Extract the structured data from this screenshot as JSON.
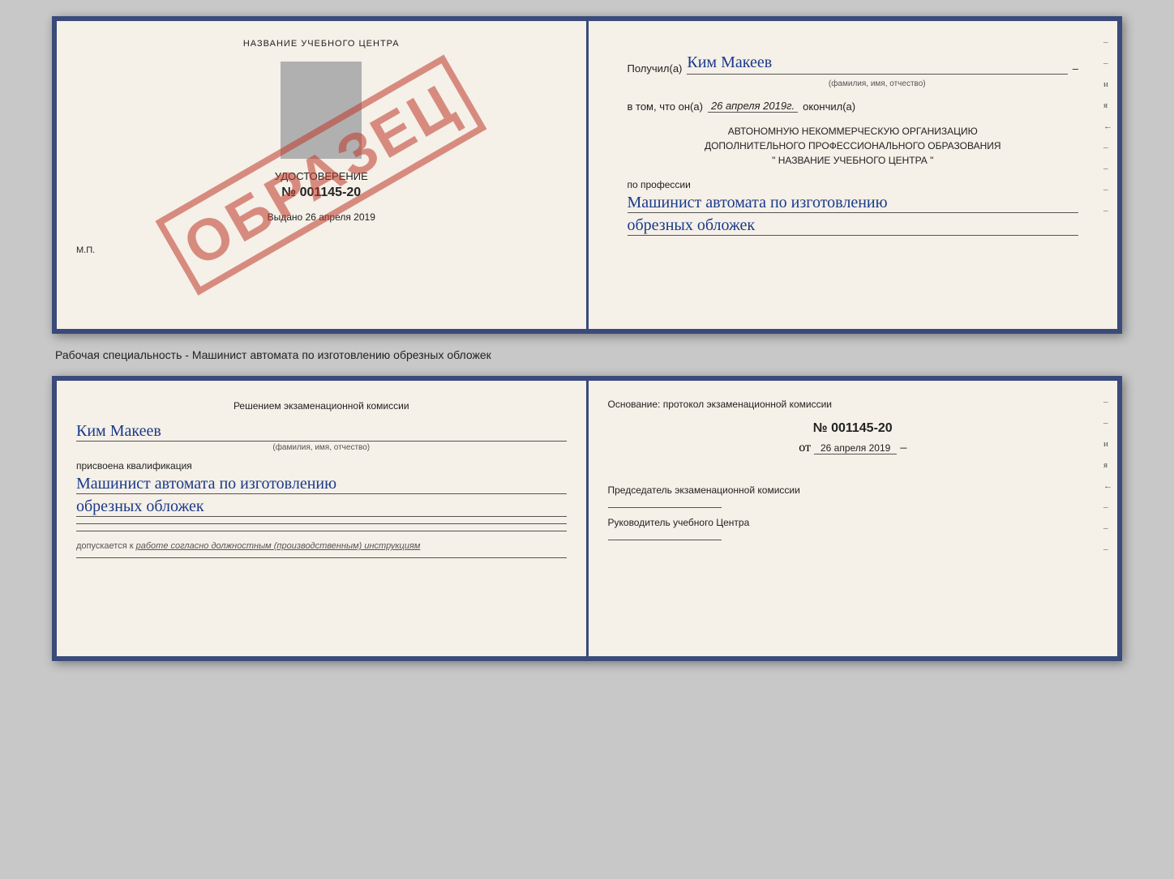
{
  "top_doc": {
    "left": {
      "title": "НАЗВАНИЕ УЧЕБНОГО ЦЕНТРА",
      "subtitle": "УДОСТОВЕРЕНИЕ",
      "number": "№ 001145-20",
      "issued_label": "Выдано",
      "issued_date": "26 апреля 2019",
      "stamp_label": "М.П.",
      "watermark": "ОБРАЗЕЦ"
    },
    "right": {
      "recipient_label": "Получил(а)",
      "recipient_name": "Ким Макеев",
      "recipient_dash": "–",
      "fio_label": "(фамилия, имя, отчество)",
      "in_that_label": "в том, что он(а)",
      "date_value": "26 апреля 2019г.",
      "finished_label": "окончил(а)",
      "org_line1": "АВТОНОМНУЮ НЕКОММЕРЧЕСКУЮ ОРГАНИЗАЦИЮ",
      "org_line2": "ДОПОЛНИТЕЛЬНОГО ПРОФЕССИОНАЛЬНОГО ОБРАЗОВАНИЯ",
      "org_line3": "\"  НАЗВАНИЕ УЧЕБНОГО ЦЕНТРА  \"",
      "profession_label": "по профессии",
      "profession_line1": "Машинист автомата по изготовлению",
      "profession_line2": "обрезных обложек"
    }
  },
  "separator": {
    "text": "Рабочая специальность - Машинист автомата по изготовлению обрезных обложек"
  },
  "bottom_doc": {
    "left": {
      "decision_label": "Решением экзаменационной комиссии",
      "person_name": "Ким Макеев",
      "fio_label": "(фамилия, имя, отчество)",
      "assigned_label": "присвоена квалификация",
      "qualification_line1": "Машинист автомата по изготовлению",
      "qualification_line2": "обрезных обложек",
      "allowed_text": "допускается к",
      "allowed_underline": "работе согласно должностным (производственным) инструкциям"
    },
    "right": {
      "basis_label": "Основание: протокол экзаменационной комиссии",
      "protocol_number": "№ 001145-20",
      "date_prefix": "от",
      "date_value": "26 апреля 2019",
      "chairman_label": "Председатель экзаменационной комиссии",
      "director_label": "Руководитель учебного Центра"
    }
  },
  "vertical_marks": [
    "–",
    "–",
    "и",
    "я",
    "←",
    "–",
    "–",
    "–",
    "–"
  ]
}
